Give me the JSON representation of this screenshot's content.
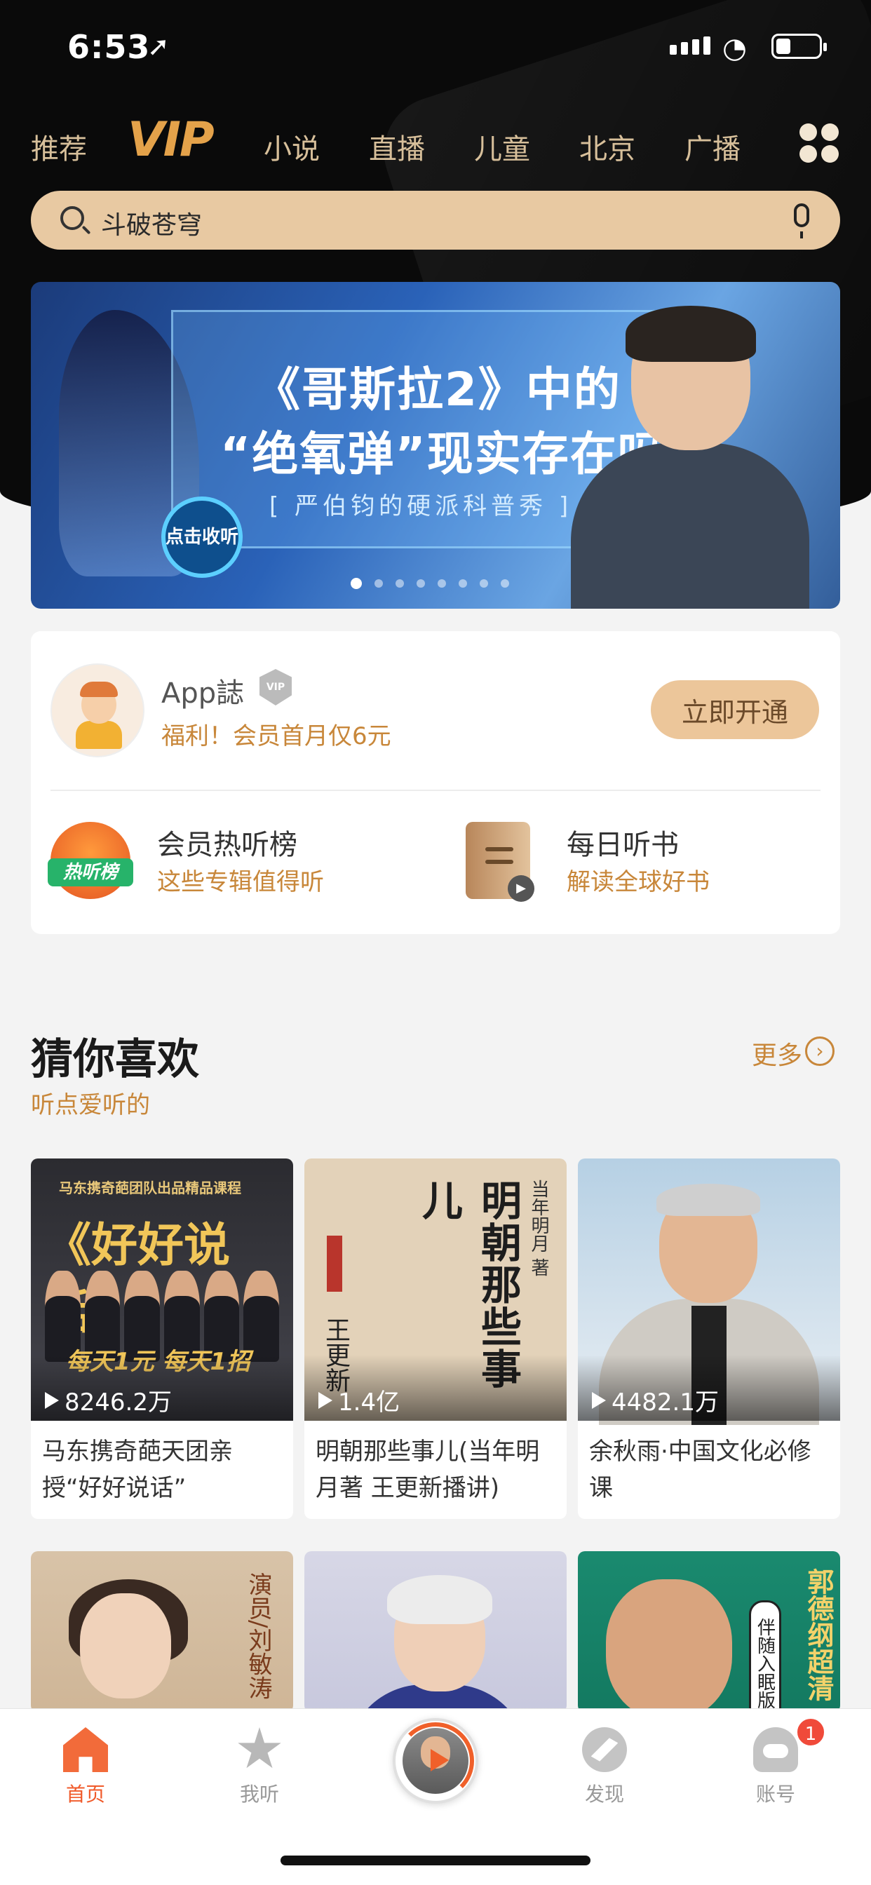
{
  "status_bar": {
    "time": "6:53"
  },
  "tabs": [
    {
      "label": "推荐"
    },
    {
      "label": "VIP"
    },
    {
      "label": "小说"
    },
    {
      "label": "直播"
    },
    {
      "label": "儿童"
    },
    {
      "label": "北京"
    },
    {
      "label": "广播"
    }
  ],
  "search": {
    "placeholder": "斗破苍穹"
  },
  "banner": {
    "title_line1": "《哥斯拉2》中的",
    "title_line2": "“绝氧弹”现实存在吗？",
    "subtitle": "[ 严伯钧的硬派科普秀 ]",
    "play_label": "点击收听",
    "dot_count": 8,
    "active_dot": 1
  },
  "vip_card": {
    "user_name": "App誌",
    "badge": "VIP",
    "promo": "福利！会员首月仅6元",
    "button": "立即开通",
    "features": [
      {
        "title": "会员热听榜",
        "subtitle": "这些专辑值得听",
        "icon": "hot-list-icon",
        "icon_text": "热听榜"
      },
      {
        "title": "每日听书",
        "subtitle": "解读全球好书",
        "icon": "book-icon"
      }
    ]
  },
  "section": {
    "title": "猜你喜欢",
    "subtitle": "听点爱听的",
    "more": "更多"
  },
  "cards": [
    {
      "plays": "8246.2万",
      "title": "马东携奇葩天团亲授“好好说话”",
      "cover_top": "马东携奇葩团队出品精品课程",
      "cover_big": "《好好说话》",
      "cover_slogan": "每天1元 每天1招"
    },
    {
      "plays": "1.4亿",
      "title": "明朝那些事儿(当年明月著 王更新播讲)",
      "cover_vertical": "明朝那些事儿",
      "cover_author": "当年明月 著",
      "cover_reader": "王更新"
    },
    {
      "plays": "4482.1万",
      "title": "余秋雨·中国文化必修课"
    },
    {
      "cover_text": "演员/刘敏涛"
    },
    {
      "cover_text": ""
    },
    {
      "cover_text": "郭德纲超清",
      "cover_tag": "伴随入眠版"
    }
  ],
  "tabbar": [
    {
      "label": "首页",
      "icon": "home-icon",
      "active": true
    },
    {
      "label": "我听",
      "icon": "star-icon",
      "active": false
    },
    {
      "label": "",
      "icon": "player-icon",
      "active": false
    },
    {
      "label": "发现",
      "icon": "compass-icon",
      "active": false
    },
    {
      "label": "账号",
      "icon": "account-icon",
      "active": false
    }
  ],
  "notification_count": "1",
  "colors": {
    "accent_gold": "#c8873a",
    "tab_active": "#f05a2a",
    "header_bg": "#0a0a0a",
    "search_bg": "#e8c9a2"
  }
}
